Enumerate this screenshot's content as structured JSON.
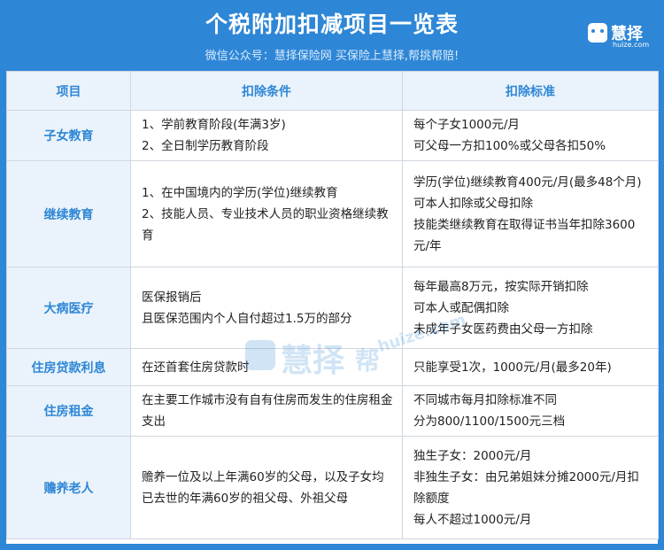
{
  "header": {
    "title": "个税附加扣减项目一览表",
    "subtitle": "微信公众号：慧择保险网  买保险上慧择,帮挑帮赔!",
    "logo_text": "慧择",
    "logo_url": "huize.com"
  },
  "watermark": {
    "brand": "慧择",
    "side": "帮",
    "url": "huize.com"
  },
  "table": {
    "headers": [
      "项目",
      "扣除条件",
      "扣除标准"
    ],
    "rows": [
      {
        "item": "子女教育",
        "conditions": [
          "1、学前教育阶段(年满3岁)",
          "2、全日制学历教育阶段"
        ],
        "standards": [
          "每个子女1000元/月",
          "可父母一方扣100%或父母各扣50%"
        ]
      },
      {
        "item": "继续教育",
        "conditions": [
          "1、在中国境内的学历(学位)继续教育",
          "2、技能人员、专业技术人员的职业资格继续教育"
        ],
        "standards": [
          "学历(学位)继续教育400元/月(最多48个月)",
          "可本人扣除或父母扣除",
          "技能类继续教育在取得证书当年扣除3600元/年"
        ]
      },
      {
        "item": "大病医疗",
        "conditions": [
          "医保报销后",
          "且医保范围内个人自付超过1.5万的部分"
        ],
        "standards": [
          "每年最高8万元，按实际开销扣除",
          "可本人或配偶扣除",
          "未成年子女医药费由父母一方扣除"
        ]
      },
      {
        "item": "住房贷款利息",
        "conditions": [
          "在还首套住房贷款时"
        ],
        "standards": [
          "只能享受1次，1000元/月(最多20年)"
        ]
      },
      {
        "item": "住房租金",
        "conditions": [
          "在主要工作城市没有自有住房而发生的住房租金支出"
        ],
        "standards": [
          "不同城市每月扣除标准不同",
          "分为800/1100/1500元三档"
        ]
      },
      {
        "item": "赡养老人",
        "conditions": [
          "赡养一位及以上年满60岁的父母，以及子女均已去世的年满60岁的祖父母、外祖父母"
        ],
        "standards": [
          "独生子女：2000元/月",
          "非独生子女：由兄弟姐妹分摊2000元/月扣除额度",
          "每人不超过1000元/月"
        ]
      }
    ]
  }
}
